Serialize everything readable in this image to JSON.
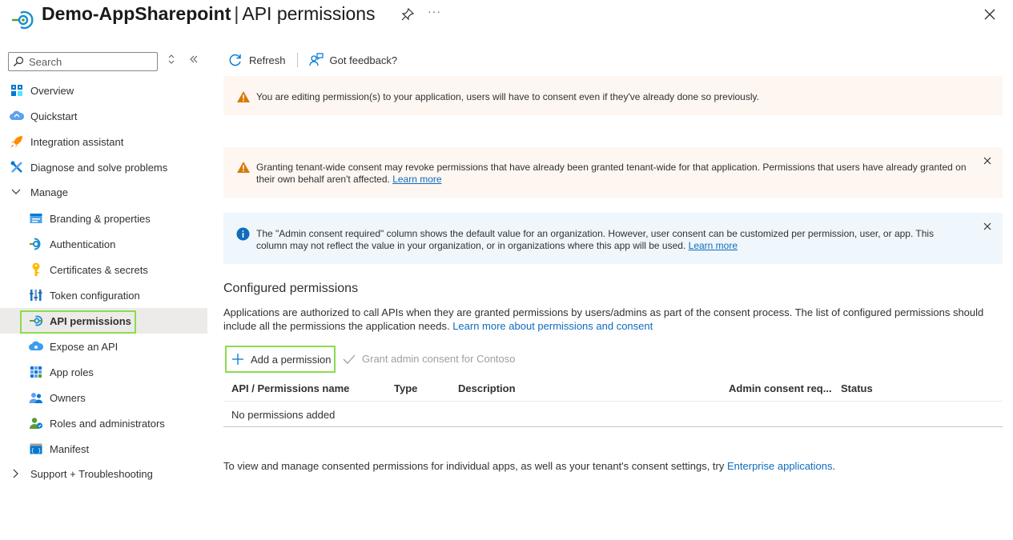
{
  "header": {
    "app_name": "Demo-AppSharepoint",
    "separator": "|",
    "page_name": "API permissions",
    "more_label": "···"
  },
  "sidebar": {
    "search_placeholder": "Search",
    "items": [
      {
        "label": "Overview",
        "icon": "overview-grid-icon"
      },
      {
        "label": "Quickstart",
        "icon": "quickstart-cloud-icon"
      },
      {
        "label": "Integration assistant",
        "icon": "rocket-icon"
      },
      {
        "label": "Diagnose and solve problems",
        "icon": "wrench-icon"
      },
      {
        "label": "Manage",
        "icon": "chevron-down-icon"
      },
      {
        "label": "Branding & properties",
        "icon": "branding-card-icon"
      },
      {
        "label": "Authentication",
        "icon": "authentication-icon"
      },
      {
        "label": "Certificates & secrets",
        "icon": "key-icon"
      },
      {
        "label": "Token configuration",
        "icon": "token-bars-icon"
      },
      {
        "label": "API permissions",
        "icon": "api-permissions-icon"
      },
      {
        "label": "Expose an API",
        "icon": "cloud-api-icon"
      },
      {
        "label": "App roles",
        "icon": "app-roles-grid-icon"
      },
      {
        "label": "Owners",
        "icon": "owners-people-icon"
      },
      {
        "label": "Roles and administrators",
        "icon": "roles-admin-icon"
      },
      {
        "label": "Manifest",
        "icon": "manifest-icon"
      },
      {
        "label": "Support + Troubleshooting",
        "icon": "chevron-right-icon"
      }
    ]
  },
  "toolbar": {
    "refresh_label": "Refresh",
    "feedback_label": "Got feedback?"
  },
  "banners": {
    "edit_warning": "You are editing permission(s) to your application, users will have to consent even if they've already done so previously.",
    "consent_warning": "Granting tenant-wide consent may revoke permissions that have already been granted tenant-wide for that application. Permissions that users have already granted on their own behalf aren't affected.",
    "consent_warning_link": "Learn more",
    "info_text": "The \"Admin consent required\" column shows the default value for an organization. However, user consent can be customized per permission, user, or app. This column may not reflect the value in your organization, or in organizations where this app will be used.",
    "info_link": "Learn more"
  },
  "configured": {
    "title": "Configured permissions",
    "description": "Applications are authorized to call APIs when they are granted permissions by users/admins as part of the consent process. The list of configured permissions should include all the permissions the application needs.",
    "description_link": "Learn more about permissions and consent",
    "add_permission_label": "Add a permission",
    "grant_consent_label": "Grant admin consent for Contoso",
    "columns": [
      "API / Permissions name",
      "Type",
      "Description",
      "Admin consent req...",
      "Status"
    ],
    "empty_text": "No permissions added"
  },
  "footer": {
    "text": "To view and manage consented permissions for individual apps, as well as your tenant's consent settings, try",
    "link": "Enterprise applications",
    "suffix": "."
  },
  "colors": {
    "accent": "#0f6cbd",
    "highlight_outline": "#8bdc4d",
    "warning": "#d67a0a",
    "warning_bg": "#fdf6f1",
    "info_bg": "#eff6fc",
    "selected_bg": "#edebe9"
  }
}
